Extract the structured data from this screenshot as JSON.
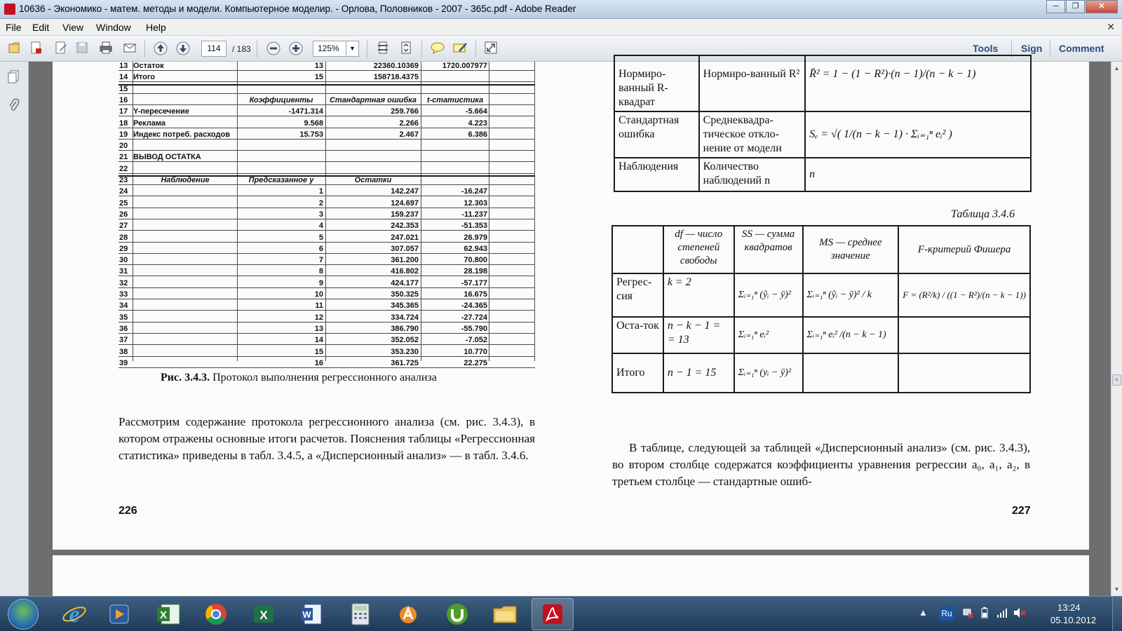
{
  "window": {
    "title": "10636 - Экономико - матем. методы и модели. Компьютерное моделир. - Орлова, Половников - 2007 - 365с.pdf - Adobe Reader",
    "minimize": "─",
    "maximize": "❐",
    "close": "✕"
  },
  "menu": {
    "items": [
      "File",
      "Edit",
      "View",
      "Window",
      "Help"
    ],
    "close_glyph": "✕"
  },
  "toolbar": {
    "page_current": "114",
    "page_total": "/ 183",
    "zoom": "125%",
    "zoom_arrow": "▼",
    "links": [
      "Tools",
      "Sign",
      "Comment"
    ]
  },
  "sheet": {
    "rows": [
      {
        "n": "13",
        "a": "Остаток",
        "b": "13",
        "c": "22360.10369",
        "d": "1720.007977"
      },
      {
        "n": "14",
        "a": "Итого",
        "b": "15",
        "c": "158718.4375",
        "d": ""
      },
      {
        "n": "15",
        "a": "",
        "b": "",
        "c": "",
        "d": ""
      },
      {
        "n": "16",
        "a": "",
        "b": "Коэффициенты",
        "c": "Стандартная ошибка",
        "d": "t-статистика",
        "hdr": true
      },
      {
        "n": "17",
        "a": "Y-пересечение",
        "b": "-1471.314",
        "c": "259.766",
        "d": "-5.664"
      },
      {
        "n": "18",
        "a": "Реклама",
        "b": "9.568",
        "c": "2.266",
        "d": "4.223"
      },
      {
        "n": "19",
        "a": "Индекс потреб. расходов",
        "b": "15.753",
        "c": "2.467",
        "d": "6.386"
      },
      {
        "n": "20",
        "a": "",
        "b": "",
        "c": "",
        "d": ""
      },
      {
        "n": "21",
        "a": "ВЫВОД ОСТАТКА",
        "b": "",
        "c": "",
        "d": ""
      },
      {
        "n": "22",
        "a": "",
        "b": "",
        "c": "",
        "d": ""
      },
      {
        "n": "23",
        "a": "Наблюдение",
        "b": "Предсказанное y",
        "c": "Остатки",
        "d": "",
        "hdr": true
      },
      {
        "n": "24",
        "a": "",
        "b": "1",
        "c": "142.247",
        "d": "-16.247"
      },
      {
        "n": "25",
        "a": "",
        "b": "2",
        "c": "124.697",
        "d": "12.303"
      },
      {
        "n": "26",
        "a": "",
        "b": "3",
        "c": "159.237",
        "d": "-11.237"
      },
      {
        "n": "27",
        "a": "",
        "b": "4",
        "c": "242.353",
        "d": "-51.353"
      },
      {
        "n": "28",
        "a": "",
        "b": "5",
        "c": "247.021",
        "d": "26.979"
      },
      {
        "n": "29",
        "a": "",
        "b": "6",
        "c": "307.057",
        "d": "62.943"
      },
      {
        "n": "30",
        "a": "",
        "b": "7",
        "c": "361.200",
        "d": "70.800"
      },
      {
        "n": "31",
        "a": "",
        "b": "8",
        "c": "416.802",
        "d": "28.198"
      },
      {
        "n": "32",
        "a": "",
        "b": "9",
        "c": "424.177",
        "d": "-57.177"
      },
      {
        "n": "33",
        "a": "",
        "b": "10",
        "c": "350.325",
        "d": "16.675"
      },
      {
        "n": "34",
        "a": "",
        "b": "11",
        "c": "345.365",
        "d": "-24.365"
      },
      {
        "n": "35",
        "a": "",
        "b": "12",
        "c": "334.724",
        "d": "-27.724"
      },
      {
        "n": "36",
        "a": "",
        "b": "13",
        "c": "386.790",
        "d": "-55.790"
      },
      {
        "n": "37",
        "a": "",
        "b": "14",
        "c": "352.052",
        "d": "-7.052"
      },
      {
        "n": "38",
        "a": "",
        "b": "15",
        "c": "353.230",
        "d": "10.770"
      },
      {
        "n": "39",
        "a": "",
        "b": "16",
        "c": "361.725",
        "d": "22.275"
      }
    ]
  },
  "left_page": {
    "caption_bold": "Рис. 3.4.3.",
    "caption_rest": " Протокол выполнения регрессионного анализа",
    "paragraph": "Рассмотрим содержание протокола регрессионного анализа (см. рис. 3.4.3), в котором отражены основные итоги расчетов. Пояснения таблицы «Регрессионная статистика» приведены в табл. 3.4.5, а «Дисперсионный анализ» — в табл. 3.4.6.",
    "page_number": "226"
  },
  "table_345": {
    "rows": [
      {
        "c1": "Нормиро-ванный R-квадрат",
        "c2": "Нормиро-ванный R²",
        "c3": "R̄² = 1 − (1 − R²)·(n − 1)/(n − k − 1)"
      },
      {
        "c1": "Стандартная ошибка",
        "c2": "Среднеквадра-тическое откло-нение от модели",
        "c3": "Sₑ = √( 1/(n − k − 1) · Σᵢ₌₁ⁿ eᵢ² )"
      },
      {
        "c1": "Наблюдения",
        "c2": "Количество наблюдений n",
        "c3": "n"
      }
    ]
  },
  "table_346": {
    "title": "Таблица 3.4.6",
    "headers": [
      "",
      "df — число степеней свободы",
      "SS — сумма квадратов",
      "MS — среднее значение",
      "F-критерий Фишера"
    ],
    "rows": [
      {
        "c0": "Регрес-сия",
        "c1": "k = 2",
        "c2": "Σᵢ₌₁ⁿ (ŷᵢ − ȳ)²",
        "c3": "Σᵢ₌₁ⁿ (ŷᵢ − ȳ)² / k",
        "c4": "F = (R²/k) / ((1 − R²)/(n − k − 1))"
      },
      {
        "c0": "Оста-ток",
        "c1": "n − k − 1 = = 13",
        "c2": "Σᵢ₌₁ⁿ eᵢ²",
        "c3": "Σᵢ₌₁ⁿ eᵢ² /(n − k − 1)",
        "c4": ""
      },
      {
        "c0": "Итого",
        "c1": "n − 1 = 15",
        "c2": "Σᵢ₌₁ⁿ (yᵢ − ȳ)²",
        "c3": "",
        "c4": ""
      }
    ]
  },
  "right_page": {
    "paragraph": "В таблице, следующей за таблицей «Дисперсионный анализ» (см. рис. 3.4.3), во втором столбце содержатся коэффициенты уравнения регрессии a₀, a₁, a₂, в третьем столбце — стандартные ошиб-",
    "page_number": "227"
  },
  "taskbar": {
    "language": "Ru",
    "time": "13:24",
    "date": "05.10.2012",
    "apps": [
      "internet-explorer",
      "media-player",
      "excel-2007",
      "chrome",
      "excel",
      "word",
      "calculator",
      "avast",
      "utorrent",
      "explorer",
      "adobe-reader"
    ]
  }
}
